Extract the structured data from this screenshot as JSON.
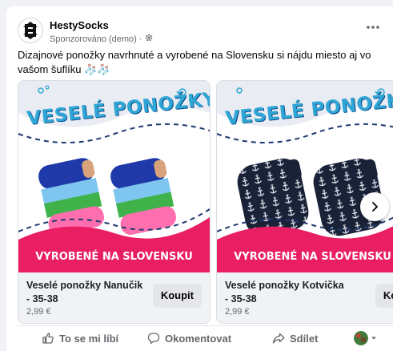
{
  "post": {
    "page_name": "HestySocks",
    "sponsored_label": "Sponzorováno (demo)",
    "separator": "·",
    "caption": "Dizajnové ponožky navrhnuté a vyrobené na Slovensku si nájdu miesto aj vo vašom šuflíku 🧦🧦"
  },
  "carousel": {
    "cards": [
      {
        "banner_top": "VESELÉ PONOŽKY",
        "banner_bottom": "VYROBENÉ NA SLOVENSKU",
        "title": "Veselé ponožky Nanučik - 35-38",
        "price": "2,99 €",
        "button": "Koupit"
      },
      {
        "banner_top": "VESELÉ PONOŽKY",
        "banner_bottom": "VYROBENÉ NA SLOVENSKU",
        "title": "Veselé ponožky Kotvička - 35-38",
        "price": "2,99 €",
        "button": "Koupit"
      }
    ]
  },
  "actions": {
    "like": "To se mi líbí",
    "comment": "Okomentovat",
    "share": "Sdílet"
  },
  "colors": {
    "banner_blue": "#2fa6d6",
    "banner_pink": "#e91e63",
    "card_info_bg": "#f0f2f5",
    "secondary_text": "#65676b"
  },
  "icons": [
    "more-options-icon",
    "globe-gear-icon",
    "next-arrow-icon",
    "like-icon",
    "comment-icon",
    "share-icon",
    "chevron-down-icon"
  ]
}
